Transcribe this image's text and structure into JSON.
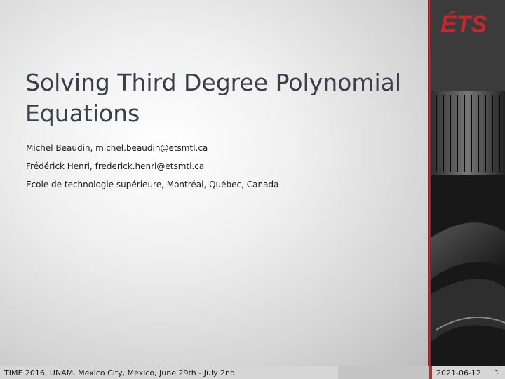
{
  "slide": {
    "title": "Solving Third Degree Polynomial Equations",
    "authors": [
      "Michel Beaudin, michel.beaudin@etsmtl.ca",
      "Frédérick Henri, frederick.henri@etsmtl.ca",
      "École de technologie supérieure, Montréal, Québec, Canada"
    ]
  },
  "logo": {
    "text": "ÉTS",
    "color": "#c8262c"
  },
  "footer": {
    "conference": "TIME 2016, UNAM, Mexico City, Mexico, June 29th - July 2nd",
    "date": "2021-06-12",
    "page": "1"
  },
  "colors": {
    "accent": "#c8262c",
    "title": "#3b3f4a"
  }
}
